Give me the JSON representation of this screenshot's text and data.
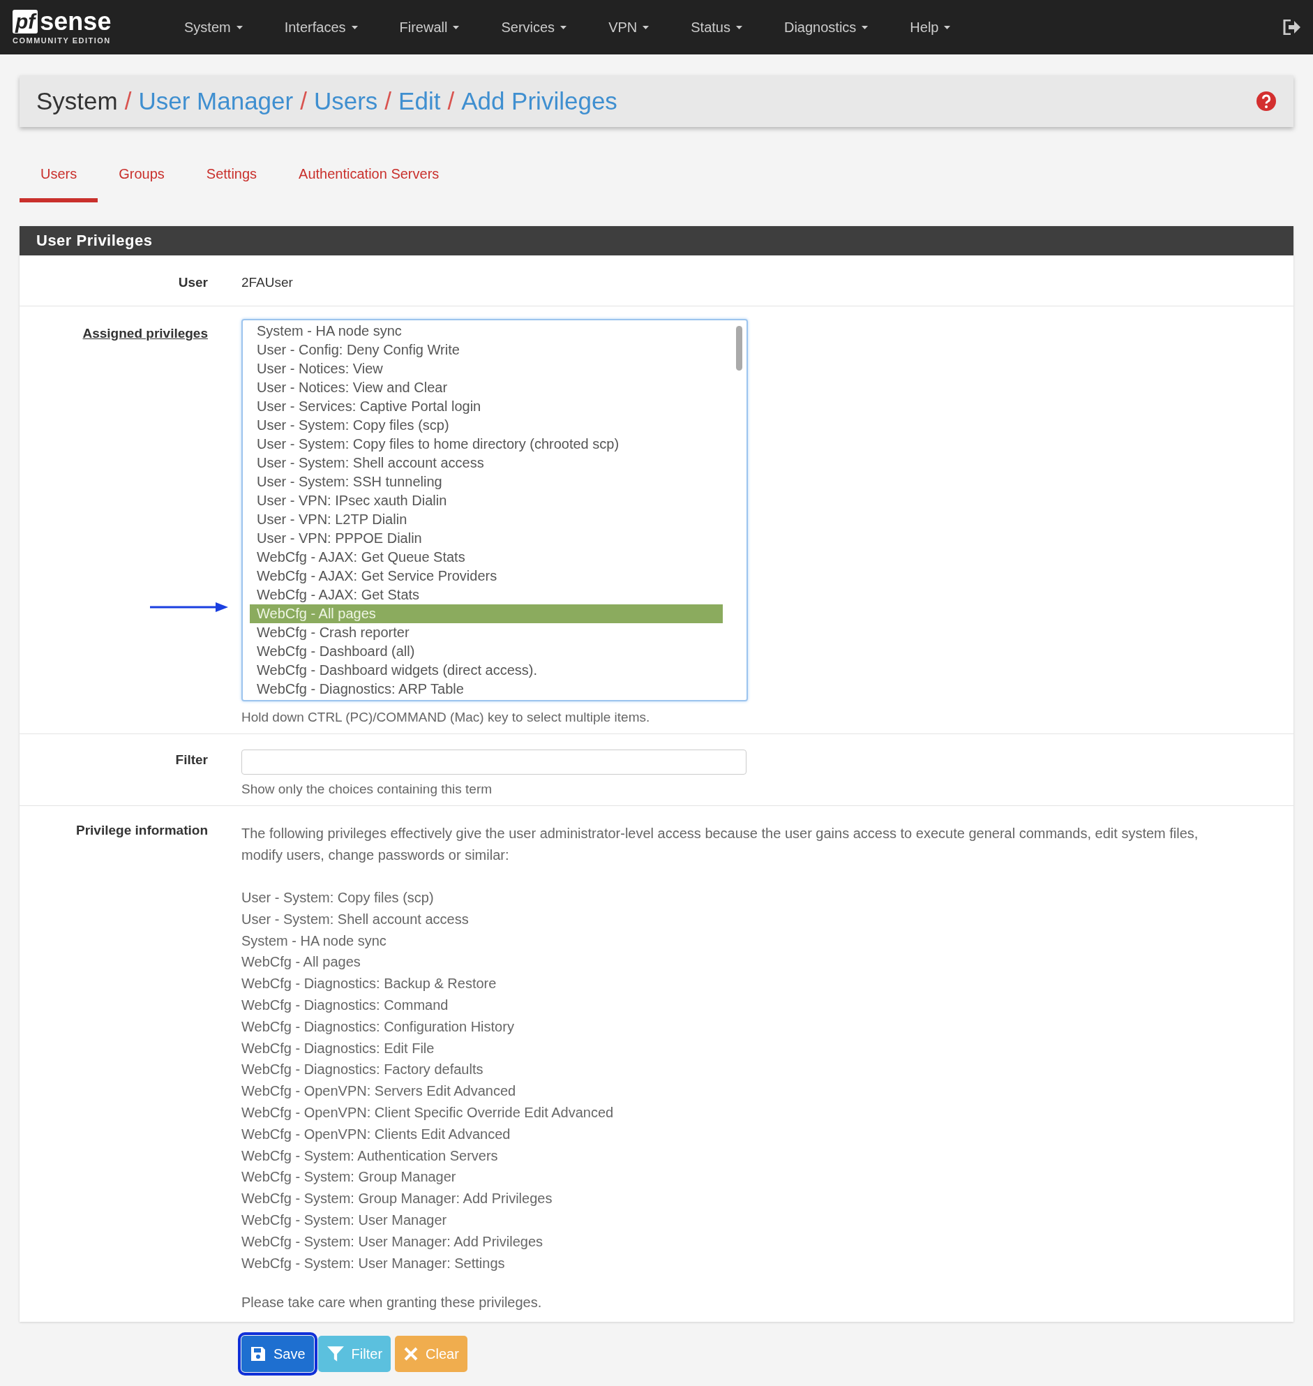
{
  "nav": {
    "logo": {
      "mark": "pf",
      "name": "sense",
      "edition": "COMMUNITY EDITION"
    },
    "menus": [
      "System",
      "Interfaces",
      "Firewall",
      "Services",
      "VPN",
      "Status",
      "Diagnostics",
      "Help"
    ]
  },
  "breadcrumb": {
    "separator": "/",
    "items": [
      {
        "label": "System",
        "link": false
      },
      {
        "label": "User Manager",
        "link": true
      },
      {
        "label": "Users",
        "link": true
      },
      {
        "label": "Edit",
        "link": true
      },
      {
        "label": "Add Privileges",
        "link": true
      }
    ]
  },
  "tabs": [
    {
      "label": "Users",
      "selected": true
    },
    {
      "label": "Groups",
      "selected": false
    },
    {
      "label": "Settings",
      "selected": false
    },
    {
      "label": "Authentication Servers",
      "selected": false
    }
  ],
  "panel": {
    "title": "User Privileges",
    "user": {
      "label": "User",
      "value": "2FAUser"
    },
    "assigned": {
      "label": "Assigned privileges",
      "help": "Hold down CTRL (PC)/COMMAND (Mac) key to select multiple items.",
      "options": [
        {
          "label": "System - HA node sync",
          "selected": false
        },
        {
          "label": "User - Config: Deny Config Write",
          "selected": false
        },
        {
          "label": "User - Notices: View",
          "selected": false
        },
        {
          "label": "User - Notices: View and Clear",
          "selected": false
        },
        {
          "label": "User - Services: Captive Portal login",
          "selected": false
        },
        {
          "label": "User - System: Copy files (scp)",
          "selected": false
        },
        {
          "label": "User - System: Copy files to home directory (chrooted scp)",
          "selected": false
        },
        {
          "label": "User - System: Shell account access",
          "selected": false
        },
        {
          "label": "User - System: SSH tunneling",
          "selected": false
        },
        {
          "label": "User - VPN: IPsec xauth Dialin",
          "selected": false
        },
        {
          "label": "User - VPN: L2TP Dialin",
          "selected": false
        },
        {
          "label": "User - VPN: PPPOE Dialin",
          "selected": false
        },
        {
          "label": "WebCfg - AJAX: Get Queue Stats",
          "selected": false
        },
        {
          "label": "WebCfg - AJAX: Get Service Providers",
          "selected": false
        },
        {
          "label": "WebCfg - AJAX: Get Stats",
          "selected": false
        },
        {
          "label": "WebCfg - All pages",
          "selected": true
        },
        {
          "label": "WebCfg - Crash reporter",
          "selected": false
        },
        {
          "label": "WebCfg - Dashboard (all)",
          "selected": false
        },
        {
          "label": "WebCfg - Dashboard widgets (direct access).",
          "selected": false
        },
        {
          "label": "WebCfg - Diagnostics: ARP Table",
          "selected": false
        }
      ]
    },
    "filter": {
      "label": "Filter",
      "help": "Show only the choices containing this term"
    },
    "info": {
      "label": "Privilege information",
      "intro": "The following privileges effectively give the user administrator-level access because the user gains access to execute general commands, edit system files, modify users, change passwords or similar:",
      "privileges": [
        "User - System: Copy files (scp)",
        "User - System: Shell account access",
        "System - HA node sync",
        "WebCfg - All pages",
        "WebCfg - Diagnostics: Backup & Restore",
        "WebCfg - Diagnostics: Command",
        "WebCfg - Diagnostics: Configuration History",
        "WebCfg - Diagnostics: Edit File",
        "WebCfg - Diagnostics: Factory defaults",
        "WebCfg - OpenVPN: Servers Edit Advanced",
        "WebCfg - OpenVPN: Client Specific Override Edit Advanced",
        "WebCfg - OpenVPN: Clients Edit Advanced",
        "WebCfg - System: Authentication Servers",
        "WebCfg - System: Group Manager",
        "WebCfg - System: Group Manager: Add Privileges",
        "WebCfg - System: User Manager",
        "WebCfg - System: User Manager: Add Privileges",
        "WebCfg - System: User Manager: Settings"
      ],
      "warning": "Please take care when granting these privileges."
    }
  },
  "buttons": [
    {
      "label": "Save",
      "kind": "save",
      "focused": true
    },
    {
      "label": "Filter",
      "kind": "filter",
      "focused": false
    },
    {
      "label": "Clear",
      "kind": "clear",
      "focused": false
    }
  ]
}
